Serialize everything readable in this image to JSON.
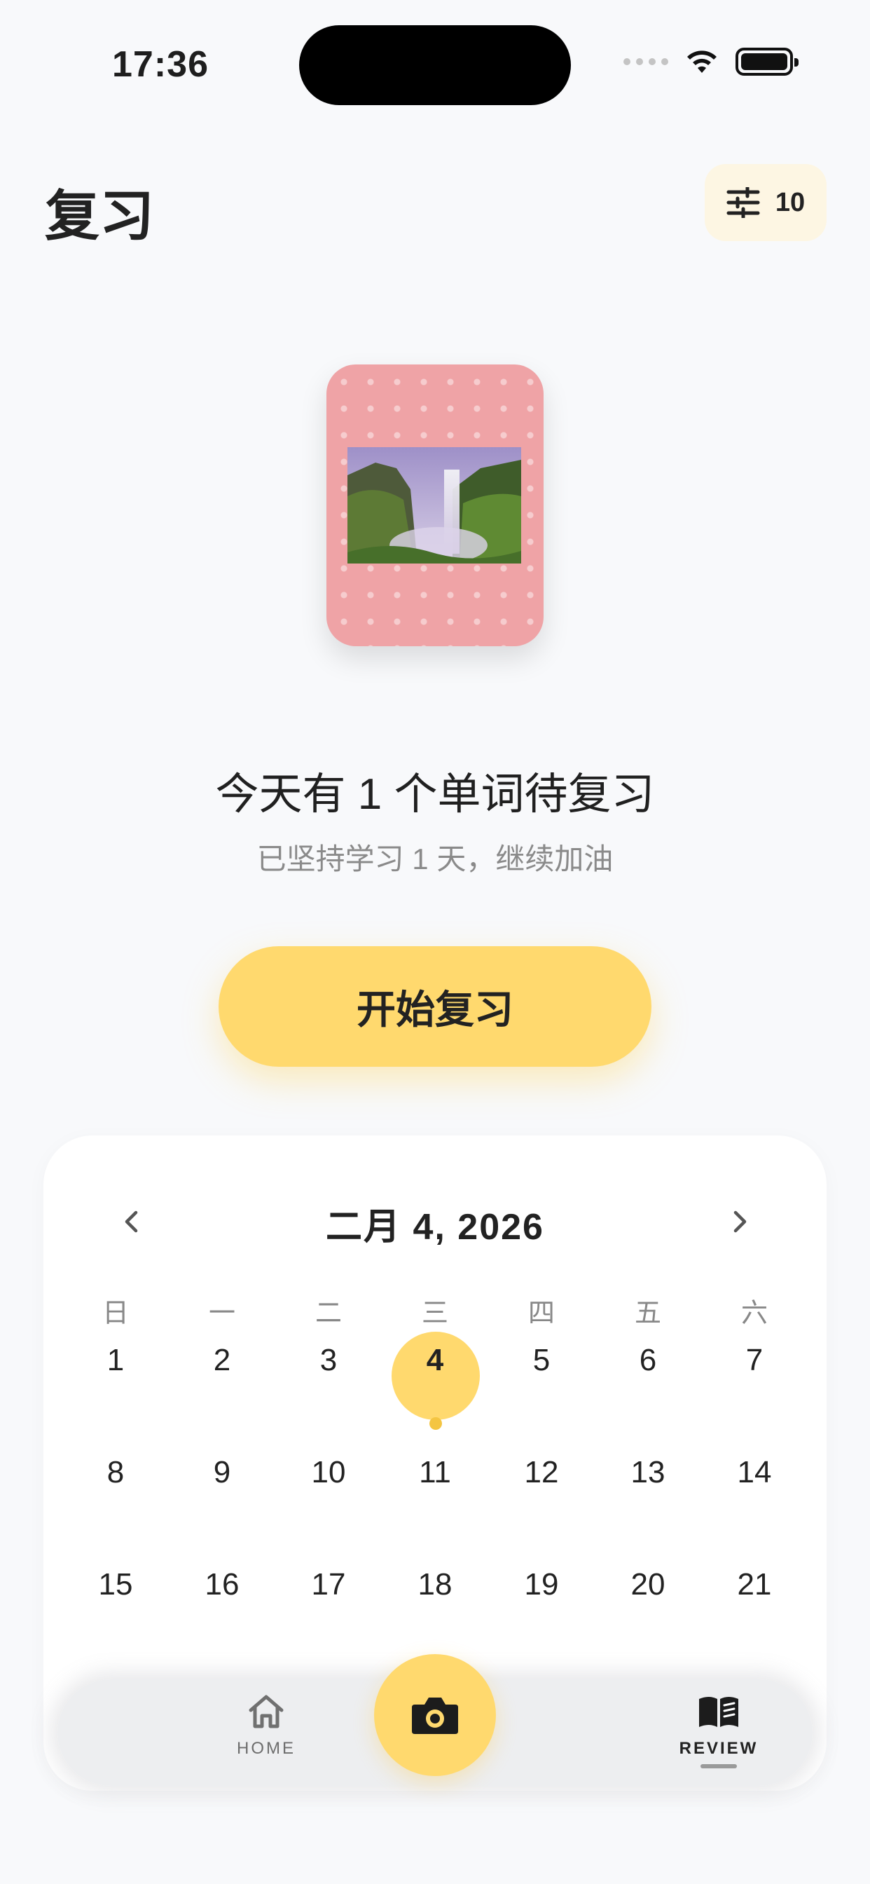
{
  "status_bar": {
    "time": "17:36"
  },
  "header": {
    "title": "复习",
    "filter_count": "10"
  },
  "review": {
    "headline": "今天有 1 个单词待复习",
    "subline": "已坚持学习 1 天，继续加油",
    "start_label": "开始复习"
  },
  "calendar": {
    "title": "二月 4, 2026",
    "weekdays": [
      "日",
      "一",
      "二",
      "三",
      "四",
      "五",
      "六"
    ],
    "days": [
      "1",
      "2",
      "3",
      "4",
      "5",
      "6",
      "7",
      "8",
      "9",
      "10",
      "11",
      "12",
      "13",
      "14",
      "15",
      "16",
      "17",
      "18",
      "19",
      "20",
      "21"
    ],
    "selected_day": "4"
  },
  "tabbar": {
    "home_label": "HOME",
    "review_label": "REVIEW"
  },
  "colors": {
    "accent": "#ffd96e",
    "card": "#efa3a6",
    "background": "#f8f9fb"
  },
  "icons": {
    "filter": "sliders-icon",
    "home": "home-icon",
    "camera": "camera-icon",
    "review": "book-icon"
  }
}
